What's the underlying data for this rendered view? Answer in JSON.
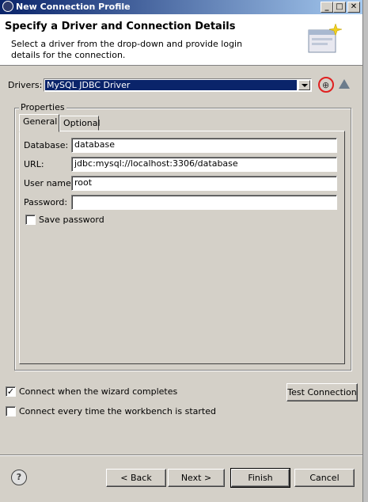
{
  "window": {
    "title": "New Connection Profile",
    "minimize": "_",
    "maximize": "□",
    "close": "✕"
  },
  "header": {
    "heading": "Specify a Driver and Connection Details",
    "description": "Select a driver from the drop-down and provide login details for the connection."
  },
  "drivers": {
    "label": "Drivers:",
    "selected": "MySQL JDBC Driver",
    "new_icon": "new-driver-icon",
    "edit_icon": "edit-driver-icon"
  },
  "properties": {
    "group_label": "Properties",
    "tabs": [
      {
        "label": "General",
        "active": true
      },
      {
        "label": "Optional",
        "active": false
      }
    ],
    "fields": {
      "database": {
        "label": "Database:",
        "value": "database"
      },
      "url": {
        "label": "URL:",
        "value": "jdbc:mysql://localhost:3306/database"
      },
      "username": {
        "label": "User name:",
        "value": "root"
      },
      "password": {
        "label": "Password:",
        "value": ""
      }
    },
    "save_password": {
      "label": "Save password",
      "checked": false
    }
  },
  "options": {
    "connect_on_complete": {
      "label": "Connect when the wizard completes",
      "checked": true
    },
    "connect_every_start": {
      "label": "Connect every time the workbench is started",
      "checked": false
    },
    "test_connection": "Test Connection"
  },
  "footer": {
    "help_icon": "help-icon",
    "help": "?",
    "back": "< Back",
    "next": "Next >",
    "finish": "Finish",
    "cancel": "Cancel"
  },
  "colors": {
    "title_bar": "#0a246a",
    "selection": "#0a246a",
    "face": "#d4d0c8",
    "highlight_circle": "#e02020"
  }
}
